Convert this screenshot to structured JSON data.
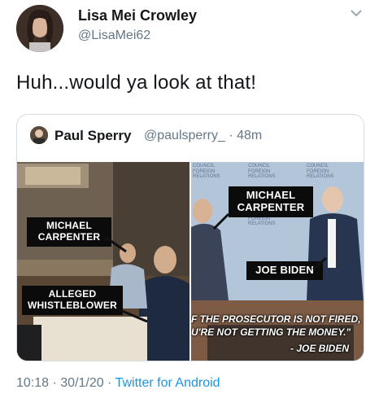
{
  "tweet": {
    "author_name": "Lisa Mei Crowley",
    "author_handle": "@LisaMei62",
    "text": "Huh...would ya look at that!",
    "time": "10:18",
    "separator": "·",
    "date": "30/1/20",
    "source": "Twitter for Android",
    "menu_icon": "chevron-down-icon"
  },
  "quoted": {
    "author_name": "Paul Sperry",
    "author_handle": "@paulsperry_",
    "age": "· 48m",
    "left_panel": {
      "label_top": "MICHAEL\nCARPENTER",
      "label_bottom": "ALLEGED\nWHISTLEBLOWER"
    },
    "right_panel": {
      "label_top": "MICHAEL\nCARPENTER",
      "label_middle": "JOE BIDEN",
      "quote_line_1": "F THE PROSECUTOR IS NOT FIRED,",
      "quote_line_2": "U'RE NOT GETTING THE MONEY.\"",
      "quote_attrib": "- JOE BIDEN",
      "backdrop_text": "COUNCIL\nFOREIGN\nRELATIONS"
    }
  },
  "colors": {
    "text": "#14171a",
    "secondary": "#657786",
    "link": "#1b95e0",
    "border": "#d6dde3"
  }
}
